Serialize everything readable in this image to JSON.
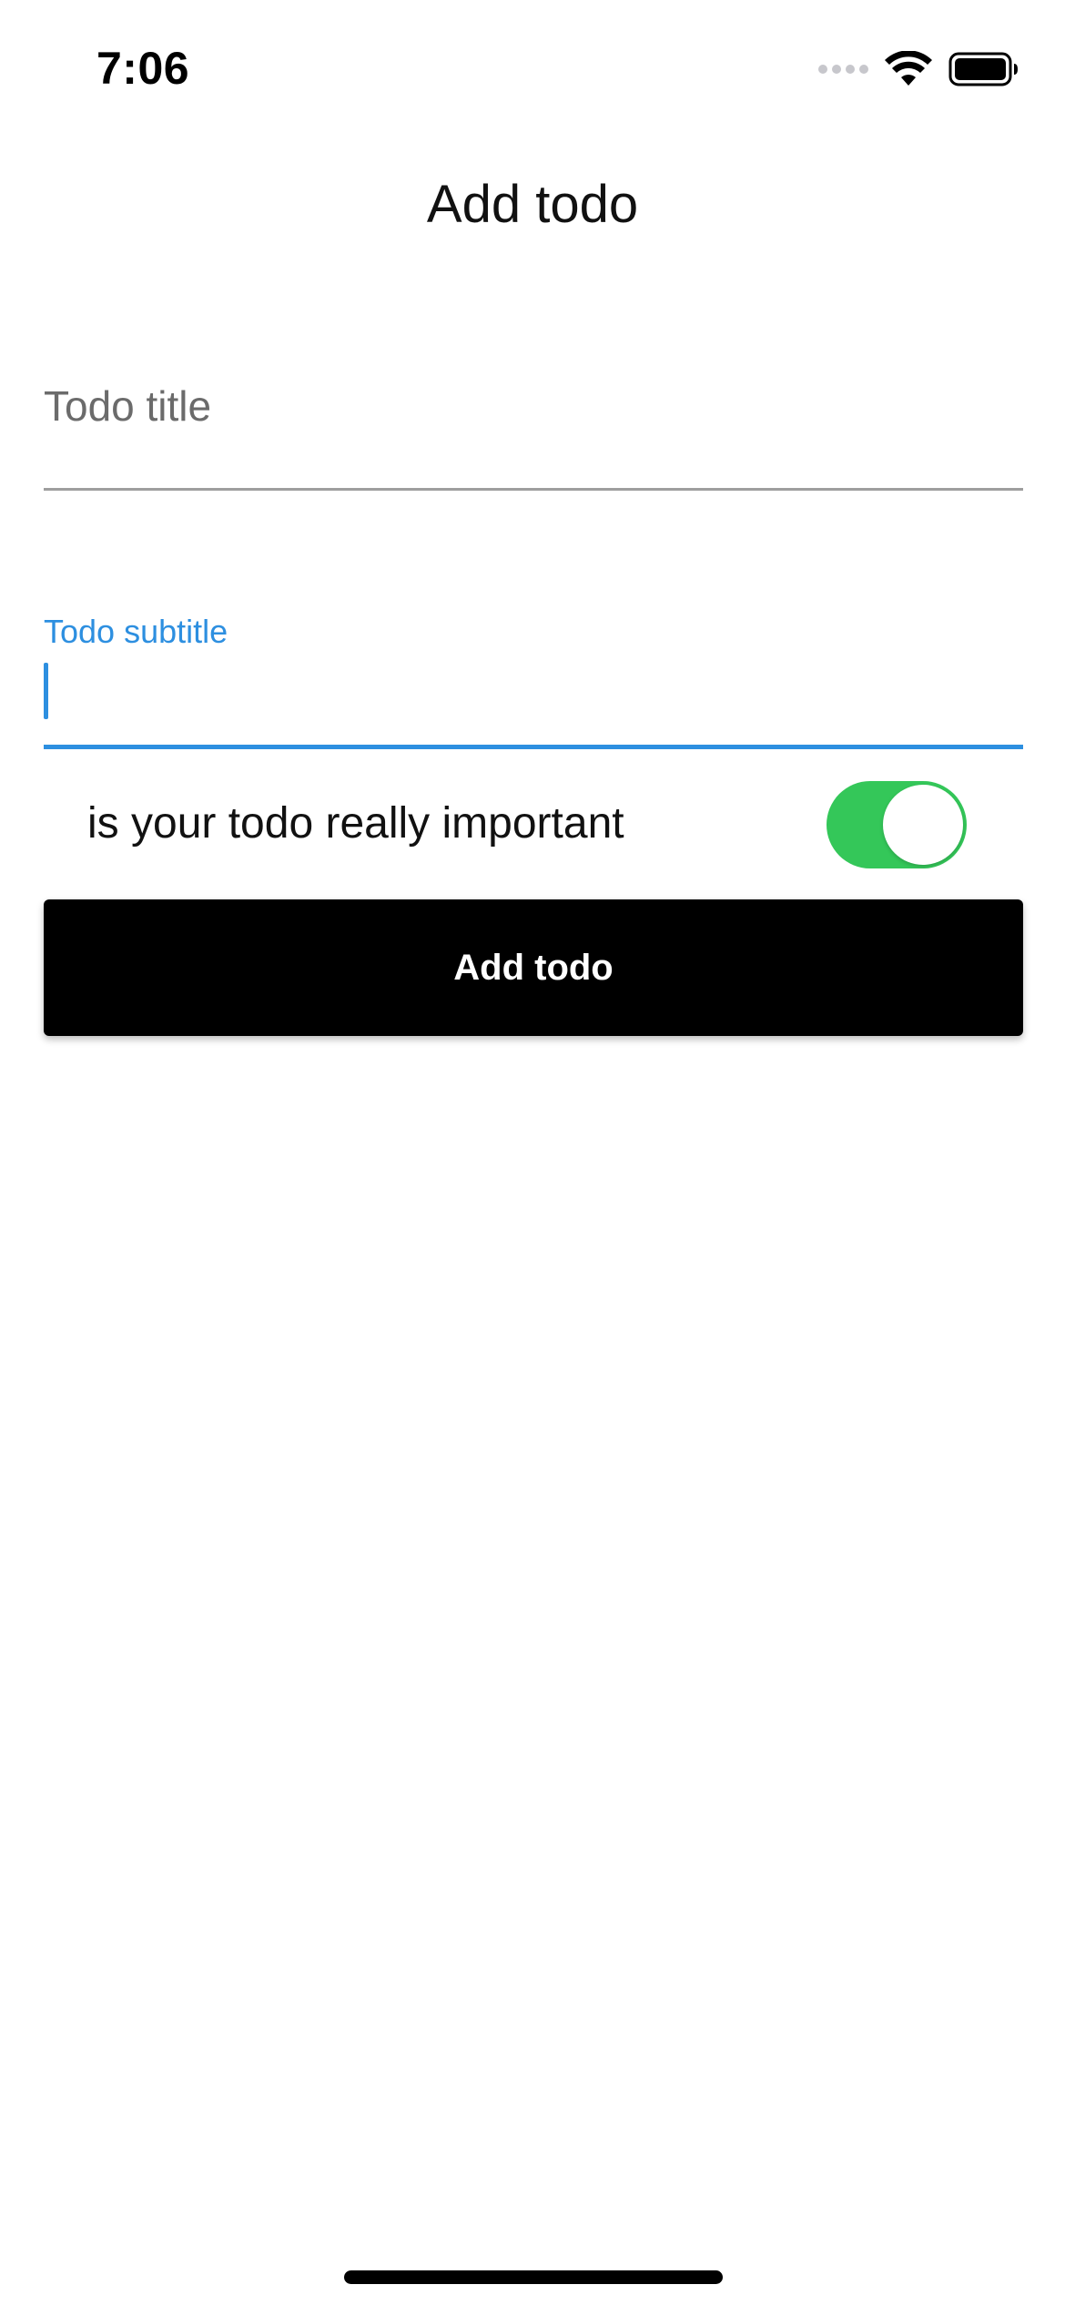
{
  "status_bar": {
    "time": "7:06",
    "icons": [
      "cellular-signal-icon",
      "wifi-icon",
      "battery-icon"
    ]
  },
  "nav": {
    "title": "Add todo"
  },
  "form": {
    "title_field": {
      "placeholder": "Todo title",
      "value": ""
    },
    "subtitle_field": {
      "label": "Todo subtitle",
      "value": "",
      "focused": true
    },
    "important_toggle": {
      "label": "is your todo really important",
      "on": true
    },
    "submit_label": "Add todo"
  },
  "colors": {
    "accent": "#2d8fe0",
    "switch_on": "#34c759",
    "button_bg": "#000000",
    "button_text": "#ffffff",
    "placeholder": "#6b6b6b",
    "underline": "#9e9e9e"
  }
}
